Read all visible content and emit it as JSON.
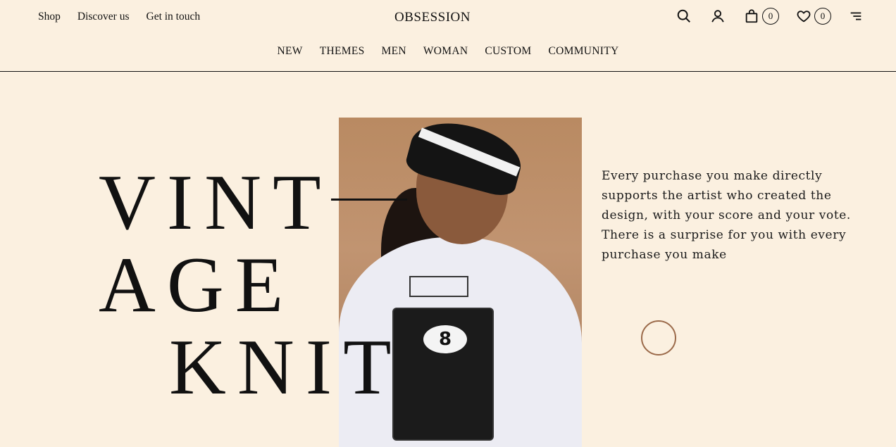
{
  "header": {
    "left_links": [
      "Shop",
      "Discover us",
      "Get in touch"
    ],
    "brand": "OBSESSION",
    "cart_count": "0",
    "wishlist_count": "0",
    "icons": [
      "search-icon",
      "user-icon",
      "bag-icon",
      "heart-icon",
      "menu-icon"
    ]
  },
  "nav": [
    "NEW",
    "THEMES",
    "MEN",
    "WOMAN",
    "CUSTOM",
    "COMMUNITY"
  ],
  "hero": {
    "headline": [
      "VINT",
      "AGE",
      "KNIT"
    ],
    "blurb": "Every purchase you make directly supports the artist who created the design, with your score and your vote. There is a surprise for you with every purchase you make",
    "photo_label": "8",
    "accent_color": "#9b6a4a"
  }
}
